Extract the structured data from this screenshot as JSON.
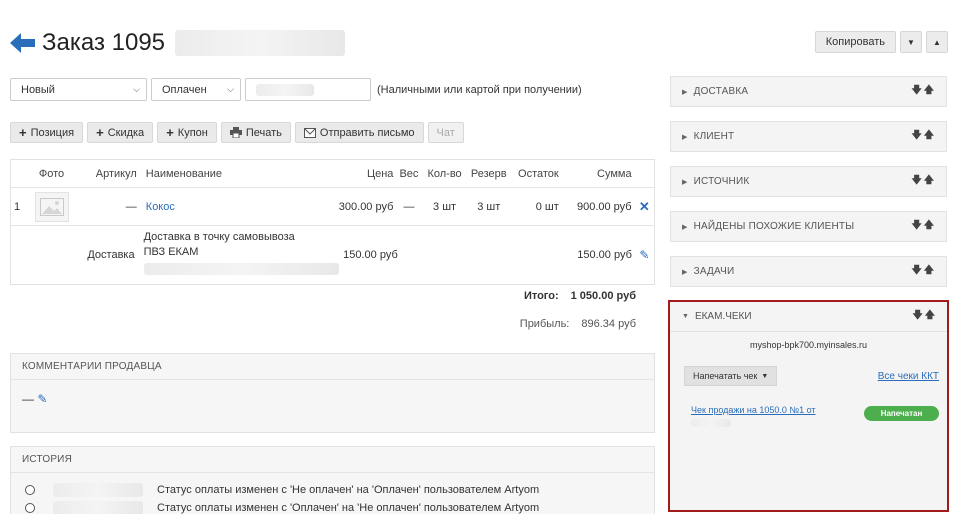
{
  "header": {
    "title": "Заказ 1095",
    "copy_label": "Копировать",
    "caret_down": "▼",
    "caret_up": "▲"
  },
  "filters": {
    "status": "Новый",
    "payment_status": "Оплачен",
    "payment_note": "(Наличными или картой при получении)"
  },
  "toolbar": {
    "position": "Позиция",
    "discount": "Скидка",
    "coupon": "Купон",
    "print": "Печать",
    "send_letter": "Отправить письмо",
    "chat": "Чат"
  },
  "table": {
    "headers": {
      "photo": "Фото",
      "article": "Артикул",
      "name": "Наименование",
      "price": "Цена",
      "weight": "Вес",
      "qty": "Кол-во",
      "reserve": "Резерв",
      "stock": "Остаток",
      "sum": "Сумма"
    },
    "item": {
      "num": "1",
      "article": "—",
      "name": "Кокос",
      "price": "300.00 руб",
      "weight": "—",
      "qty": "3 шт",
      "reserve": "3 шт",
      "stock": "0 шт",
      "sum": "900.00 руб"
    },
    "delivery": {
      "label": "Доставка",
      "name_line1": "Доставка в точку самовывоза",
      "name_line2": "ПВЗ ЕКАМ",
      "price": "150.00 руб",
      "sum": "150.00 руб"
    }
  },
  "totals": {
    "total_label": "Итого:",
    "total_value": "1 050.00 руб",
    "profit_label": "Прибыль:",
    "profit_value": "896.34 руб"
  },
  "comments": {
    "title": "КОММЕНТАРИИ ПРОДАВЦА",
    "value": "—"
  },
  "history": {
    "title": "ИСТОРИЯ",
    "entries": [
      "Статус оплаты изменен с 'Не оплачен' на 'Оплачен' пользователем Artyom",
      "Статус оплаты изменен с 'Оплачен' на 'Не оплачен' пользователем Artyom"
    ]
  },
  "sidebar": {
    "arrows": "🡇🡅",
    "sections": [
      "ДОСТАВКА",
      "КЛИЕНТ",
      "ИСТОЧНИК",
      "НАЙДЕНЫ ПОХОЖИЕ КЛИЕНТЫ",
      "ЗАДАЧИ"
    ]
  },
  "ekam": {
    "title": "ЕКАМ.ЧЕКИ",
    "shop": "myshop-bpk700.myinsales.ru",
    "print_button": "Напечатать чек",
    "all_checks": "Все чеки ККТ",
    "receipt_link": "Чек продажи на 1050.0 №1 от",
    "status_badge": "Напечатан"
  },
  "colors": {
    "link": "#2a6ebb",
    "ekam_border": "#a21b1b",
    "badge_green": "#4cae4c"
  }
}
